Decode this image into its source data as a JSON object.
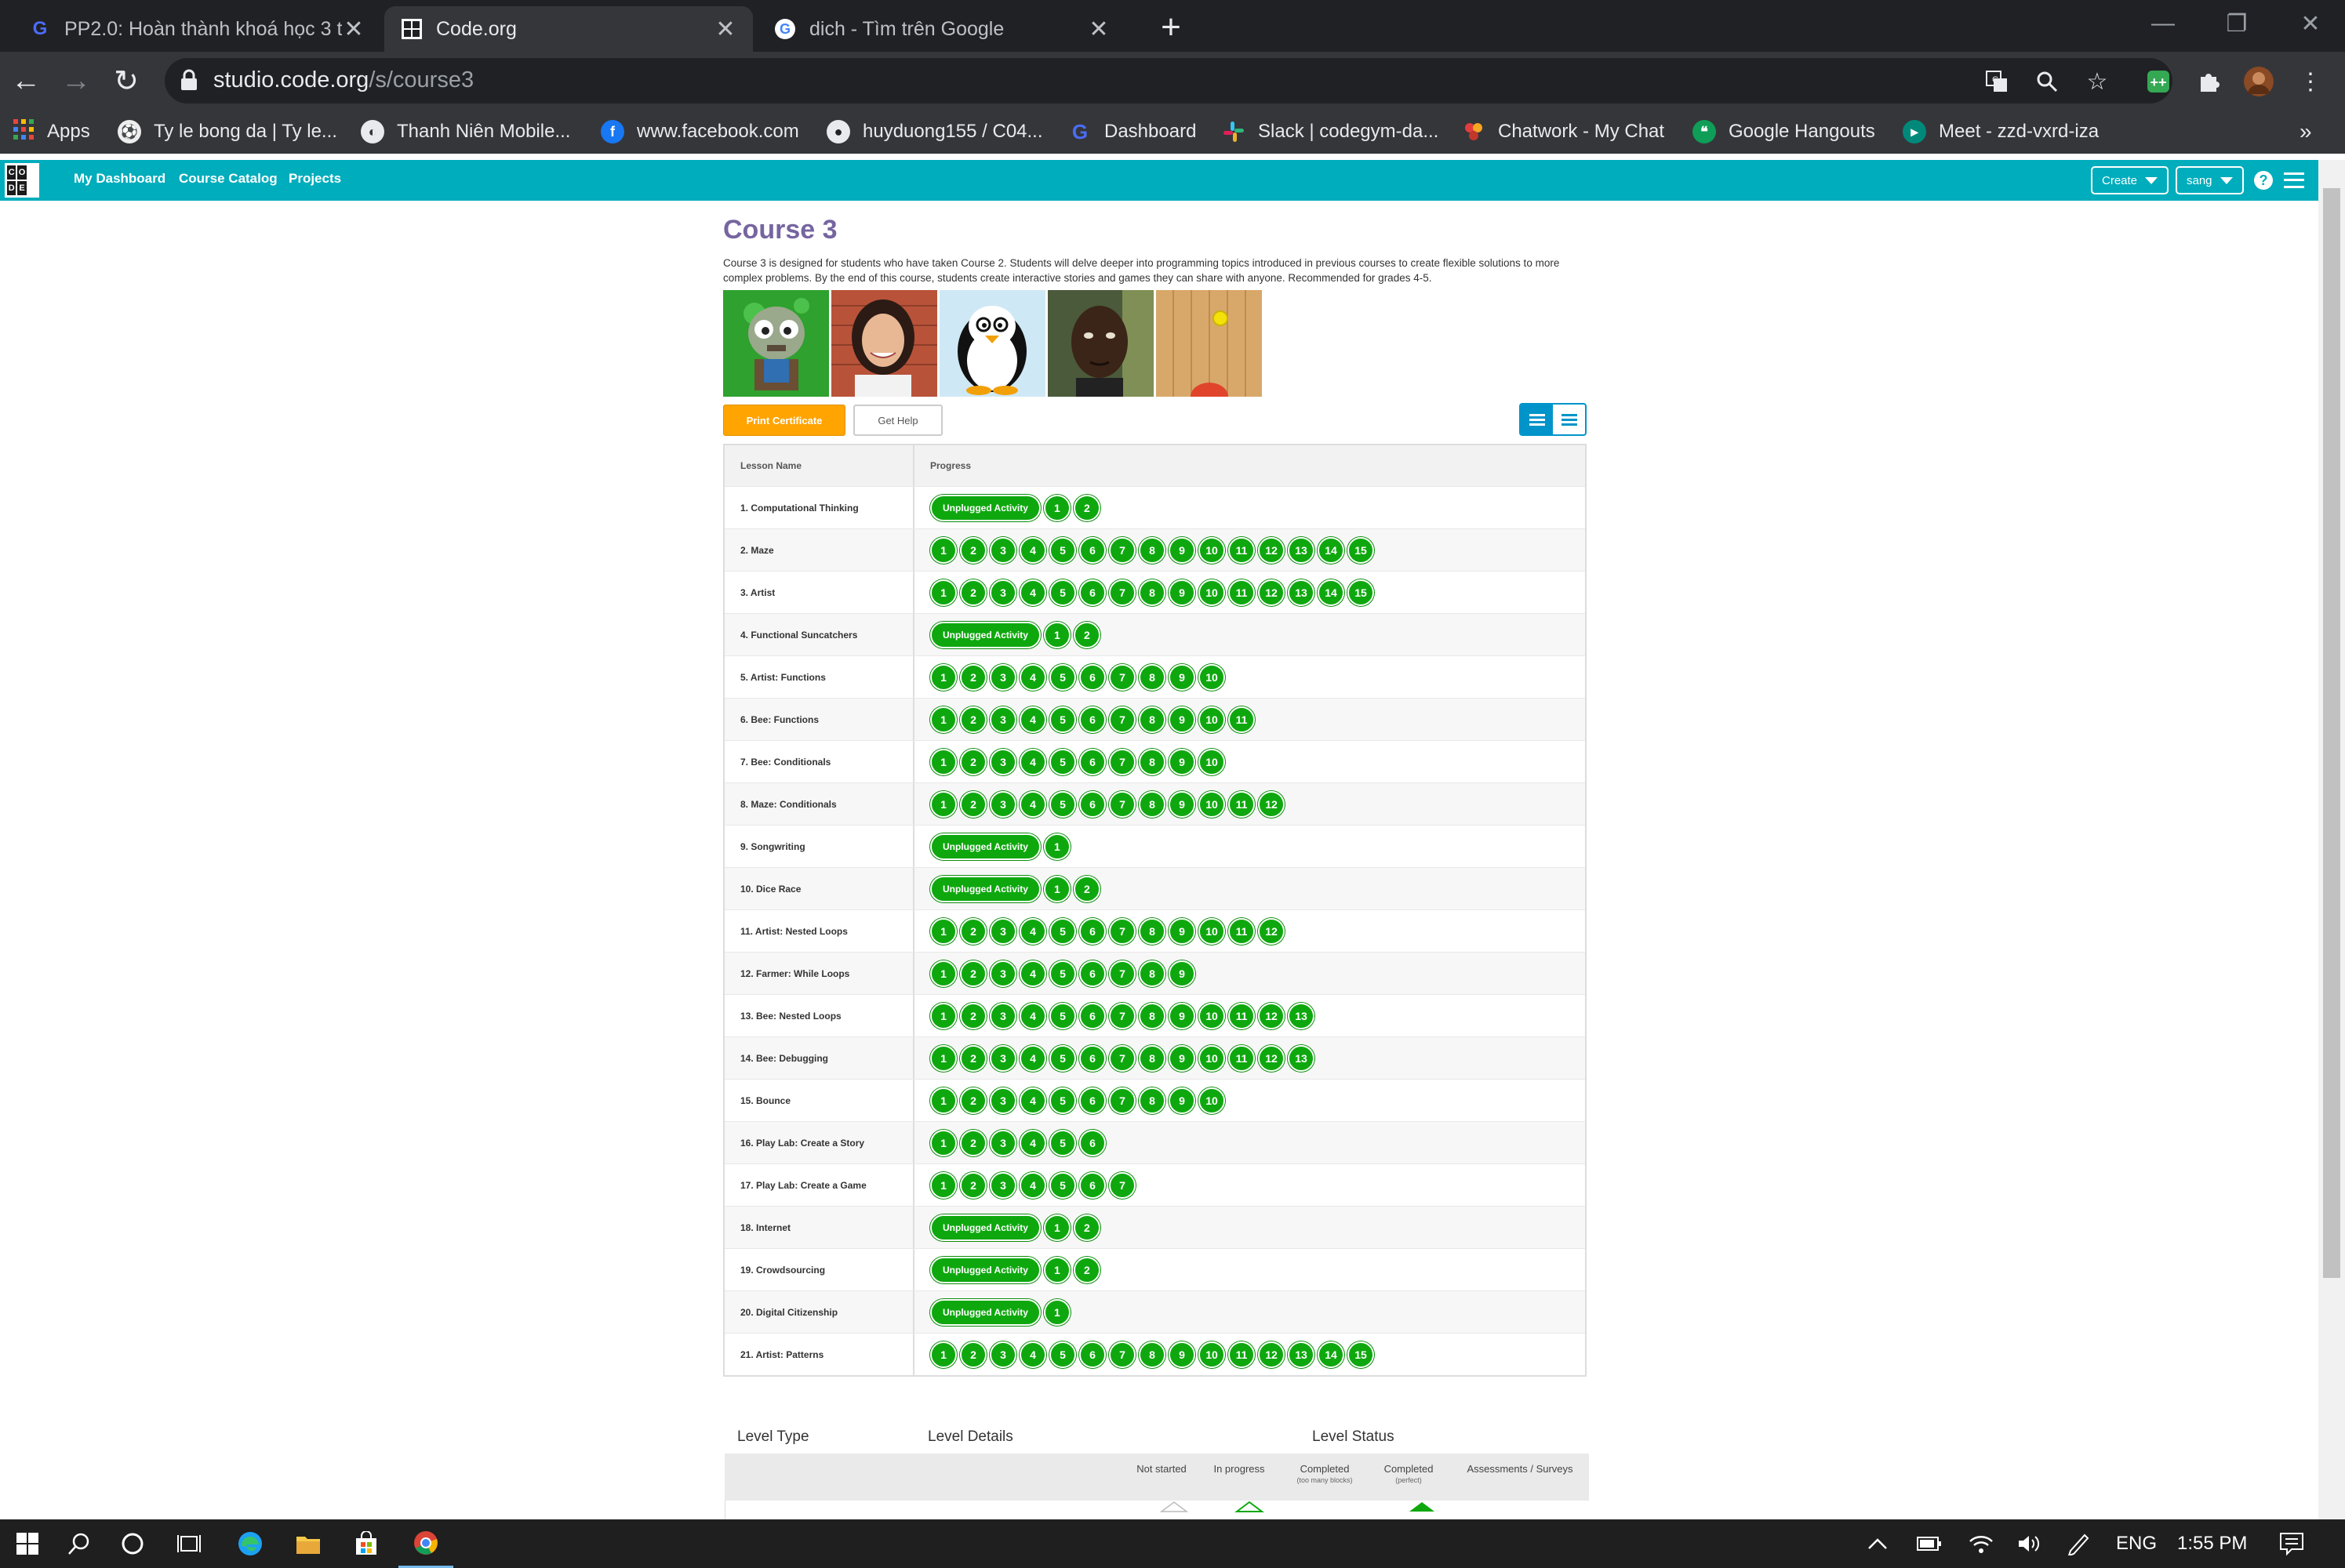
{
  "browser": {
    "tabs": [
      {
        "title": "PP2.0: Hoàn thành khoá học 3 trên Code.org",
        "favicon": "gym-g-icon",
        "active": false
      },
      {
        "title": "Code.org",
        "favicon": "codeorg-grid-icon",
        "active": true
      },
      {
        "title": "dich - Tìm trên Google",
        "favicon": "google-icon",
        "active": false
      }
    ],
    "url_host": "studio.code.org",
    "url_path": "/s/course3",
    "bookmarks": [
      {
        "label": "Apps",
        "icon": "apps-grid-icon",
        "color": "#e8453c"
      },
      {
        "label": "Ty le bong da | Ty le...",
        "icon": "soccer-ball-icon",
        "color": "#666666"
      },
      {
        "label": "Thanh Niên Mobile...",
        "icon": "globe-icon",
        "color": "#555555"
      },
      {
        "label": "www.facebook.com",
        "icon": "facebook-icon",
        "color": "#1877f2"
      },
      {
        "label": "huyduong155 / C04...",
        "icon": "github-icon",
        "color": "#333333"
      },
      {
        "label": "Dashboard",
        "icon": "gym-g-icon",
        "color": "#3b5bdb"
      },
      {
        "label": "Slack | codegym-da...",
        "icon": "slack-icon",
        "color": "#4a154b"
      },
      {
        "label": "Chatwork - My Chat",
        "icon": "chatwork-icon",
        "color": "#e23d3d"
      },
      {
        "label": "Google Hangouts",
        "icon": "hangouts-icon",
        "color": "#0f9d58"
      },
      {
        "label": "Meet - zzd-vxrd-iza",
        "icon": "meet-icon",
        "color": "#00897b"
      }
    ],
    "more_bookmarks": "»"
  },
  "codeorg_header": {
    "logo_letters": [
      "C",
      "O",
      "D",
      "E",
      "",
      ""
    ],
    "nav": [
      "My Dashboard",
      "Course Catalog",
      "Projects"
    ],
    "create_label": "Create",
    "user_label": "sang",
    "help_glyph": "?"
  },
  "course": {
    "title": "Course 3",
    "description": "Course 3 is designed for students who have taken Course 2. Students will delve deeper into programming topics introduced in previous courses to create flexible solutions to more complex problems. By the end of this course, students create interactive stories and games they can share with anyone. Recommended for grades 4-5.",
    "thumbnails": [
      "zombie-character",
      "woman-portrait",
      "penguin-character",
      "man-portrait",
      "wood-court-ball"
    ],
    "print_certificate": "Print Certificate",
    "get_help": "Get Help"
  },
  "progress_table": {
    "col_lesson": "Lesson Name",
    "col_progress": "Progress",
    "unplugged_label": "Unplugged Activity",
    "lessons": [
      {
        "name": "1. Computational Thinking",
        "unplugged": true,
        "levels": 2
      },
      {
        "name": "2. Maze",
        "unplugged": false,
        "levels": 15
      },
      {
        "name": "3. Artist",
        "unplugged": false,
        "levels": 15
      },
      {
        "name": "4. Functional Suncatchers",
        "unplugged": true,
        "levels": 2
      },
      {
        "name": "5. Artist: Functions",
        "unplugged": false,
        "levels": 10
      },
      {
        "name": "6. Bee: Functions",
        "unplugged": false,
        "levels": 11
      },
      {
        "name": "7. Bee: Conditionals",
        "unplugged": false,
        "levels": 10
      },
      {
        "name": "8. Maze: Conditionals",
        "unplugged": false,
        "levels": 12
      },
      {
        "name": "9. Songwriting",
        "unplugged": true,
        "levels": 1
      },
      {
        "name": "10. Dice Race",
        "unplugged": true,
        "levels": 2
      },
      {
        "name": "11. Artist: Nested Loops",
        "unplugged": false,
        "levels": 12
      },
      {
        "name": "12. Farmer: While Loops",
        "unplugged": false,
        "levels": 9
      },
      {
        "name": "13. Bee: Nested Loops",
        "unplugged": false,
        "levels": 13
      },
      {
        "name": "14. Bee: Debugging",
        "unplugged": false,
        "levels": 13
      },
      {
        "name": "15. Bounce",
        "unplugged": false,
        "levels": 10
      },
      {
        "name": "16. Play Lab: Create a Story",
        "unplugged": false,
        "levels": 6
      },
      {
        "name": "17. Play Lab: Create a Game",
        "unplugged": false,
        "levels": 7
      },
      {
        "name": "18. Internet",
        "unplugged": true,
        "levels": 2
      },
      {
        "name": "19. Crowdsourcing",
        "unplugged": true,
        "levels": 2
      },
      {
        "name": "20. Digital Citizenship",
        "unplugged": true,
        "levels": 1
      },
      {
        "name": "21. Artist: Patterns",
        "unplugged": false,
        "levels": 15
      }
    ]
  },
  "key": {
    "level_type": "Level Type",
    "level_details": "Level Details",
    "level_status": "Level Status",
    "status_columns": [
      {
        "label": "Not started",
        "sub": ""
      },
      {
        "label": "In progress",
        "sub": ""
      },
      {
        "label": "Completed",
        "sub": "(too many blocks)"
      },
      {
        "label": "Completed",
        "sub": "(perfect)"
      },
      {
        "label": "Assessments / Surveys",
        "sub": ""
      }
    ]
  },
  "taskbar": {
    "language": "ENG",
    "time": "1:55 PM"
  },
  "colors": {
    "codeorg_teal": "#00adbc",
    "progress_green": "#0ea80e",
    "title_purple": "#7665a0",
    "print_orange": "#ffa400"
  }
}
